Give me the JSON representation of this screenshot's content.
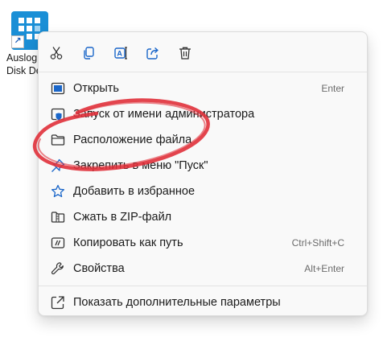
{
  "desktop_icon": {
    "label_line1": "Auslogics",
    "label_line2": "Disk Defrag"
  },
  "quick_actions": [
    {
      "name": "cut",
      "icon": "scissors-icon"
    },
    {
      "name": "copy",
      "icon": "copy-icon"
    },
    {
      "name": "rename",
      "icon": "rename-icon"
    },
    {
      "name": "share",
      "icon": "share-icon"
    },
    {
      "name": "delete",
      "icon": "trash-icon"
    }
  ],
  "menu": {
    "items": [
      {
        "label": "Открыть",
        "shortcut": "Enter",
        "icon": "app-window-icon"
      },
      {
        "label": "Запуск от имени администратора",
        "shortcut": "",
        "icon": "admin-shield-icon"
      },
      {
        "label": "Расположение файла",
        "shortcut": "",
        "icon": "folder-icon"
      },
      {
        "label": "Закрепить в меню \"Пуск\"",
        "shortcut": "",
        "icon": "pin-icon"
      },
      {
        "label": "Добавить в избранное",
        "shortcut": "",
        "icon": "star-icon"
      },
      {
        "label": "Сжать в ZIP-файл",
        "shortcut": "",
        "icon": "zip-icon"
      },
      {
        "label": "Копировать как путь",
        "shortcut": "Ctrl+Shift+C",
        "icon": "copy-path-icon"
      },
      {
        "label": "Свойства",
        "shortcut": "Alt+Enter",
        "icon": "wrench-icon"
      }
    ],
    "more": {
      "label": "Показать дополнительные параметры",
      "icon": "show-more-icon"
    }
  },
  "colors": {
    "accent_blue": "#1a66c9",
    "highlight_red": "#e0303a",
    "menu_background": "#f9f9f9"
  }
}
